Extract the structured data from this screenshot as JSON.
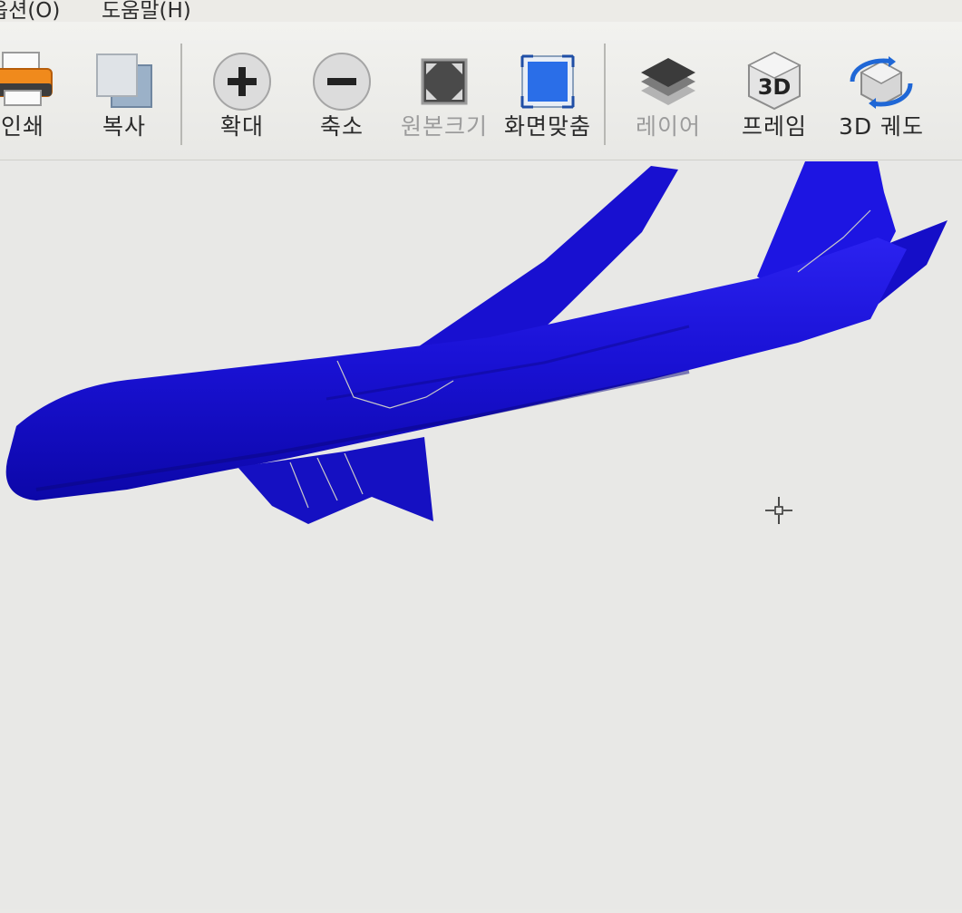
{
  "menu": {
    "items": [
      {
        "label": "옵션(O)"
      },
      {
        "label": "도움말(H)"
      }
    ]
  },
  "toolbar": {
    "items": [
      {
        "label": "인쇄",
        "icon": "printer-icon",
        "enabled": true
      },
      {
        "label": "복사",
        "icon": "copy-icon",
        "enabled": true
      },
      {
        "label": "확대",
        "icon": "zoom-in-icon",
        "enabled": true
      },
      {
        "label": "축소",
        "icon": "zoom-out-icon",
        "enabled": true
      },
      {
        "label": "원본크기",
        "icon": "original-size-icon",
        "enabled": false
      },
      {
        "label": "화면맞춤",
        "icon": "fit-screen-icon",
        "enabled": true
      },
      {
        "label": "레이어",
        "icon": "layers-icon",
        "enabled": false
      },
      {
        "label": "프레임",
        "icon": "3d-frame-icon",
        "enabled": true
      },
      {
        "label": "3D 궤도",
        "icon": "3d-orbit-icon",
        "enabled": true
      }
    ]
  },
  "viewport": {
    "model": "airplane-3d-model",
    "model_color": "#1a12d6",
    "background": "#e8e8e6"
  }
}
